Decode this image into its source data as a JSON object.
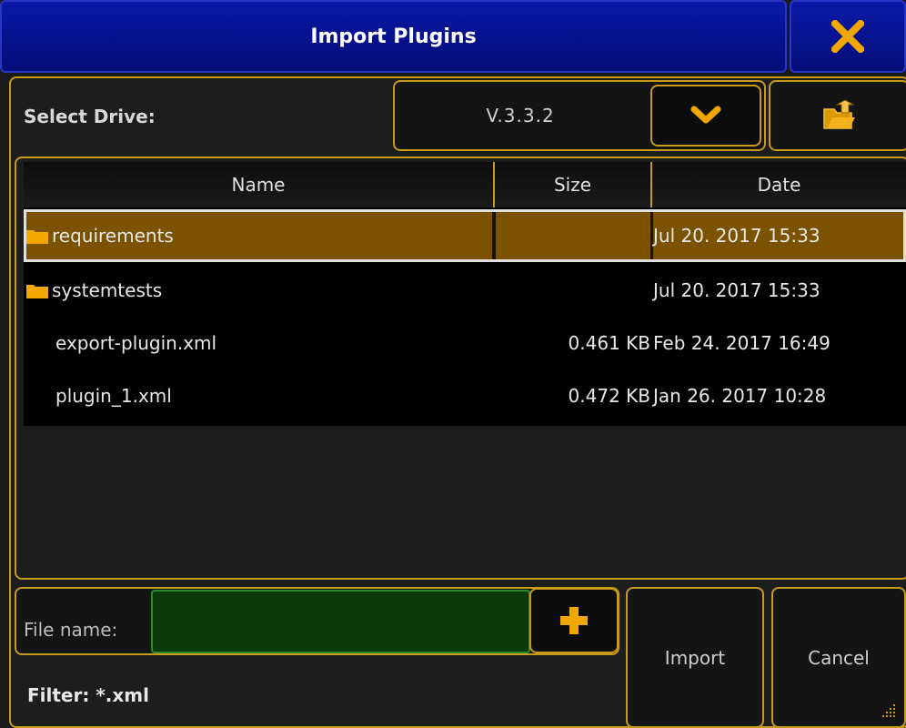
{
  "window": {
    "title": "Import Plugins"
  },
  "icons": {
    "close": "close-icon",
    "dropdown": "chevron-down-icon",
    "parent_folder": "folder-up-icon",
    "add": "plus-icon",
    "folder": "folder-icon"
  },
  "colors": {
    "title_bar": "#061089",
    "accent": "#c89a1a",
    "selection": "#7a5200",
    "input_bg": "#0a3a0a"
  },
  "drive": {
    "label": "Select Drive:",
    "value": "V.3.3.2"
  },
  "table": {
    "columns": [
      "Name",
      "Size",
      "Date"
    ],
    "rows": [
      {
        "name": "requirements",
        "size": "",
        "date": "Jul 20. 2017 15:33",
        "type": "folder",
        "selected": true
      },
      {
        "name": "systemtests",
        "size": "",
        "date": "Jul 20. 2017 15:33",
        "type": "folder",
        "selected": false
      },
      {
        "name": "export-plugin.xml",
        "size": "0.461 KB",
        "date": "Feb 24. 2017 16:49",
        "type": "file",
        "selected": false
      },
      {
        "name": "plugin_1.xml",
        "size": "0.472 KB",
        "date": "Jan 26. 2017 10:28",
        "type": "file",
        "selected": false
      }
    ]
  },
  "file_name": {
    "label": "File name:",
    "value": ""
  },
  "filter": {
    "text": "Filter: *.xml"
  },
  "buttons": {
    "import": "Import",
    "cancel": "Cancel"
  }
}
